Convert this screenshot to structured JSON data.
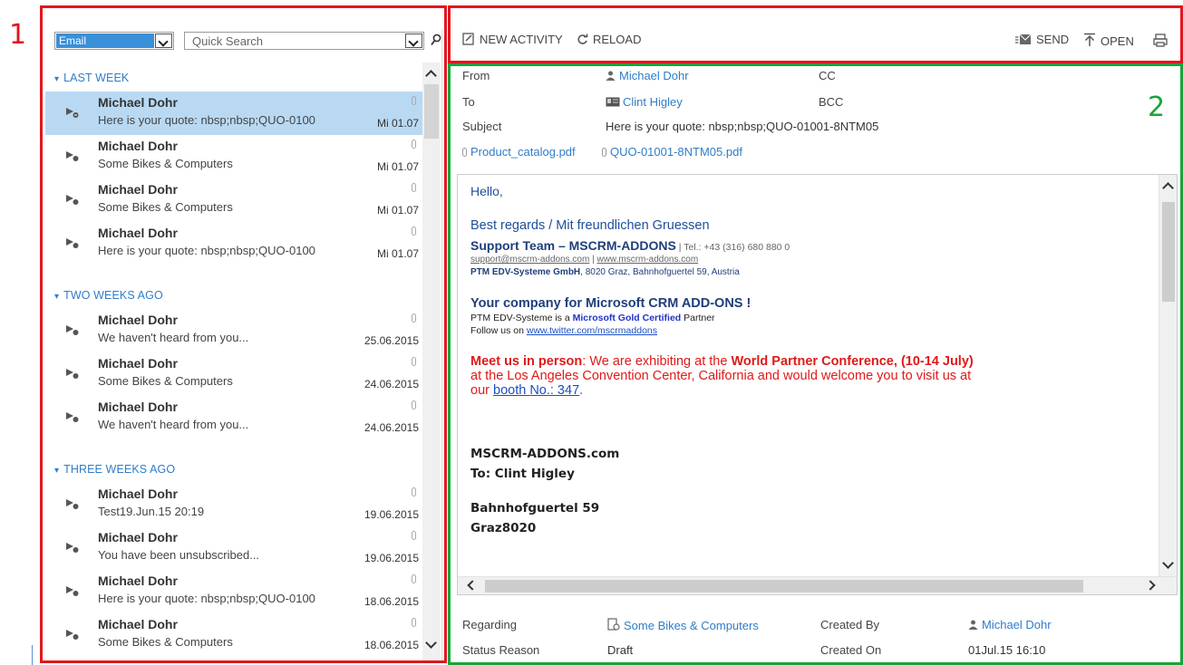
{
  "annotations": {
    "label_1": "1",
    "label_2": "2",
    "red": "#e2161d",
    "green": "#18a43a"
  },
  "left": {
    "entity_select": "Email",
    "search_placeholder": "Quick Search",
    "groups": [
      {
        "label": "LAST WEEK",
        "rows": [
          {
            "sender": "Michael Dohr",
            "subject": "Here is your quote: nbsp;nbsp;QUO-0100",
            "date": "Mi 01.07",
            "selected": true
          },
          {
            "sender": "Michael Dohr",
            "subject": "Some Bikes & Computers",
            "date": "Mi 01.07"
          },
          {
            "sender": "Michael Dohr",
            "subject": "Some Bikes & Computers",
            "date": "Mi 01.07"
          },
          {
            "sender": "Michael Dohr",
            "subject": "Here is your quote: nbsp;nbsp;QUO-0100",
            "date": "Mi 01.07"
          }
        ]
      },
      {
        "label": "TWO WEEKS AGO",
        "rows": [
          {
            "sender": "Michael Dohr",
            "subject": "We haven't heard from you...",
            "date": "25.06.2015"
          },
          {
            "sender": "Michael Dohr",
            "subject": "Some Bikes & Computers",
            "date": "24.06.2015"
          },
          {
            "sender": "Michael Dohr",
            "subject": "We haven't heard from you...",
            "date": "24.06.2015"
          }
        ]
      },
      {
        "label": "THREE WEEKS AGO",
        "rows": [
          {
            "sender": "Michael Dohr",
            "subject": "Test19.Jun.15 20:19",
            "date": "19.06.2015"
          },
          {
            "sender": "Michael Dohr",
            "subject": "You have been unsubscribed...",
            "date": "19.06.2015"
          },
          {
            "sender": "Michael Dohr",
            "subject": "Here is your quote: nbsp;nbsp;QUO-0100",
            "date": "18.06.2015"
          },
          {
            "sender": "Michael Dohr",
            "subject": "Some Bikes & Computers",
            "date": "18.06.2015"
          }
        ]
      }
    ]
  },
  "toolbar": {
    "new_activity": "NEW ACTIVITY",
    "reload": "RELOAD",
    "send": "SEND",
    "open": "OPEN"
  },
  "email": {
    "from_label": "From",
    "from_value": "Michael Dohr",
    "cc_label": "CC",
    "to_label": "To",
    "to_value": "Clint Higley",
    "bcc_label": "BCC",
    "subject_label": "Subject",
    "subject_value": "Here is your quote: nbsp;nbsp;QUO-01001-8NTM05",
    "attachments": [
      "Product_catalog.pdf",
      "QUO-01001-8NTM05.pdf"
    ],
    "body": {
      "hello": "Hello,",
      "regards": "Best regards / Mit freundlichen Gruessen",
      "team": "Support Team – MSCRM-ADDONS",
      "tel": " | Tel.: +43 (316) 680 880 0",
      "support_email": "support@mscrm-addons.com",
      "sep": " | ",
      "website": "www.mscrm-addons.com",
      "company_bold": "PTM EDV-Systeme GmbH",
      "company_addr": ", 8020 Graz, Bahnhofguertel 59, Austria",
      "tagline": "Your company for Microsoft CRM ADD-ONS !",
      "partner_pre": "PTM EDV-Systeme is a ",
      "partner_gold": "Microsoft Gold Certified",
      "partner_post": " Partner",
      "follow_pre": "Follow us on ",
      "follow_link": "www.twitter.com/mscrmaddons",
      "meet_bold": "Meet us in person",
      "meet_1": ": We are exhibiting at the ",
      "meet_wpc": "World Partner Conference,",
      "meet_dates": "(10-14 July)",
      "meet_2": " at the Los Angeles Convention Center, California and would welcome you to visit us at our ",
      "meet_booth": "booth No.: 347",
      "meet_end": ".",
      "sig1": "MSCRM-ADDONS.com",
      "sig2": "To: Clint Higley",
      "sig3": "Bahnhofguertel 59",
      "sig4": "Graz8020"
    },
    "regarding_label": "Regarding",
    "regarding_value": "Some Bikes & Computers",
    "created_by_label": "Created By",
    "created_by_value": "Michael Dohr",
    "status_label": "Status Reason",
    "status_value": "Draft",
    "created_on_label": "Created On",
    "created_on_value": "01Jul.15 16:10"
  }
}
